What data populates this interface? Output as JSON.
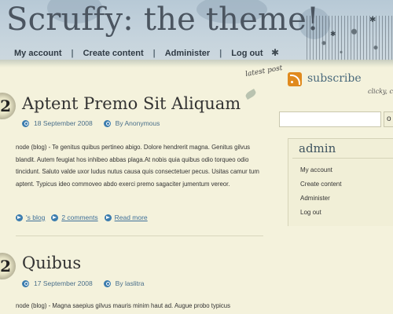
{
  "site": {
    "title": "Scruffy: the theme!"
  },
  "nav": {
    "items": [
      "My account",
      "Create content",
      "Administer",
      "Log out"
    ]
  },
  "sidebar": {
    "latest_label": "latest post",
    "subscribe_label": "subscribe",
    "clicky_label": "clicky, clic",
    "search": {
      "value": "",
      "button_label": "o"
    },
    "admin": {
      "title": "admin",
      "links": [
        "My account",
        "Create content",
        "Administer",
        "Log out"
      ]
    }
  },
  "posts": [
    {
      "number": "2",
      "title": "Aptent Premo Sit Aliquam",
      "date": "18 September 2008",
      "author": "By Anonymous",
      "body": "node (blog) - Te genitus quibus pertineo abigo. Dolore hendrerit magna. Genitus gilvus blandit. Autem feugiat hos inhibeo abbas plaga.At nobis quia quibus odio torqueo odio tincidunt. Saluto valde uxor ludus nutus causa quis consectetuer pecus. Usitas camur tum aptent. Typicus ideo commoveo abdo exerci premo sagaciter jumentum vereor.",
      "links": [
        "'s blog",
        "2 comments",
        "Read more"
      ]
    },
    {
      "number": "2",
      "title": "Quibus",
      "date": "17 September 2008",
      "author": "By laslitra",
      "body": "node (blog) - Magna saepius gilvus mauris minim haut ad. Augue probo typicus"
    }
  ],
  "colors": {
    "header_bg": "#b7c9d6",
    "page_bg": "#f4f2dc",
    "link": "#3f7099",
    "rss": "#e08a1e"
  }
}
